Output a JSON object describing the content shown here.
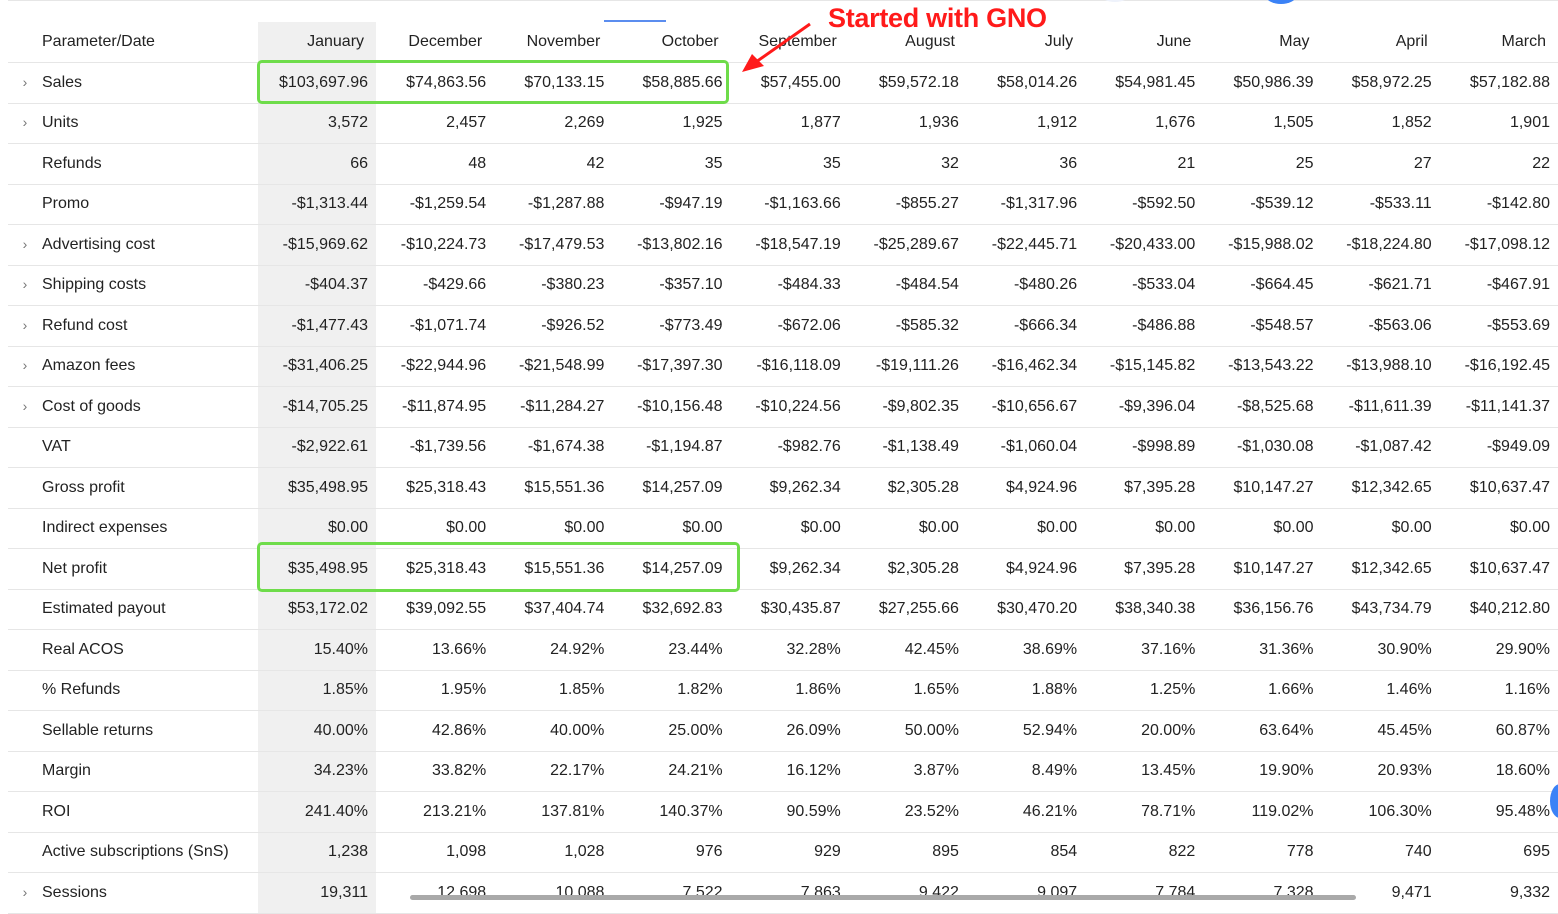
{
  "table": {
    "header_label": "Parameter/Date",
    "months": [
      "January",
      "December",
      "November",
      "October",
      "September",
      "August",
      "July",
      "June",
      "May",
      "April",
      "March"
    ],
    "rows": [
      {
        "label": "Sales",
        "expandable": true,
        "values": [
          "$103,697.96",
          "$74,863.56",
          "$70,133.15",
          "$58,885.66",
          "$57,455.00",
          "$59,572.18",
          "$58,014.26",
          "$54,981.45",
          "$50,986.39",
          "$58,972.25",
          "$57,182.88"
        ]
      },
      {
        "label": "Units",
        "expandable": true,
        "values": [
          "3,572",
          "2,457",
          "2,269",
          "1,925",
          "1,877",
          "1,936",
          "1,912",
          "1,676",
          "1,505",
          "1,852",
          "1,901"
        ]
      },
      {
        "label": "Refunds",
        "expandable": false,
        "values": [
          "66",
          "48",
          "42",
          "35",
          "35",
          "32",
          "36",
          "21",
          "25",
          "27",
          "22"
        ]
      },
      {
        "label": "Promo",
        "expandable": false,
        "values": [
          "-$1,313.44",
          "-$1,259.54",
          "-$1,287.88",
          "-$947.19",
          "-$1,163.66",
          "-$855.27",
          "-$1,317.96",
          "-$592.50",
          "-$539.12",
          "-$533.11",
          "-$142.80"
        ]
      },
      {
        "label": "Advertising cost",
        "expandable": true,
        "values": [
          "-$15,969.62",
          "-$10,224.73",
          "-$17,479.53",
          "-$13,802.16",
          "-$18,547.19",
          "-$25,289.67",
          "-$22,445.71",
          "-$20,433.00",
          "-$15,988.02",
          "-$18,224.80",
          "-$17,098.12"
        ]
      },
      {
        "label": "Shipping costs",
        "expandable": true,
        "values": [
          "-$404.37",
          "-$429.66",
          "-$380.23",
          "-$357.10",
          "-$484.33",
          "-$484.54",
          "-$480.26",
          "-$533.04",
          "-$664.45",
          "-$621.71",
          "-$467.91"
        ]
      },
      {
        "label": "Refund cost",
        "expandable": true,
        "values": [
          "-$1,477.43",
          "-$1,071.74",
          "-$926.52",
          "-$773.49",
          "-$672.06",
          "-$585.32",
          "-$666.34",
          "-$486.88",
          "-$548.57",
          "-$563.06",
          "-$553.69"
        ]
      },
      {
        "label": "Amazon fees",
        "expandable": true,
        "values": [
          "-$31,406.25",
          "-$22,944.96",
          "-$21,548.99",
          "-$17,397.30",
          "-$16,118.09",
          "-$19,111.26",
          "-$16,462.34",
          "-$15,145.82",
          "-$13,543.22",
          "-$13,988.10",
          "-$16,192.45"
        ]
      },
      {
        "label": "Cost of goods",
        "expandable": true,
        "values": [
          "-$14,705.25",
          "-$11,874.95",
          "-$11,284.27",
          "-$10,156.48",
          "-$10,224.56",
          "-$9,802.35",
          "-$10,656.67",
          "-$9,396.04",
          "-$8,525.68",
          "-$11,611.39",
          "-$11,141.37"
        ]
      },
      {
        "label": "VAT",
        "expandable": false,
        "values": [
          "-$2,922.61",
          "-$1,739.56",
          "-$1,674.38",
          "-$1,194.87",
          "-$982.76",
          "-$1,138.49",
          "-$1,060.04",
          "-$998.89",
          "-$1,030.08",
          "-$1,087.42",
          "-$949.09"
        ]
      },
      {
        "label": "Gross profit",
        "expandable": false,
        "values": [
          "$35,498.95",
          "$25,318.43",
          "$15,551.36",
          "$14,257.09",
          "$9,262.34",
          "$2,305.28",
          "$4,924.96",
          "$7,395.28",
          "$10,147.27",
          "$12,342.65",
          "$10,637.47"
        ]
      },
      {
        "label": "Indirect expenses",
        "expandable": false,
        "values": [
          "$0.00",
          "$0.00",
          "$0.00",
          "$0.00",
          "$0.00",
          "$0.00",
          "$0.00",
          "$0.00",
          "$0.00",
          "$0.00",
          "$0.00"
        ]
      },
      {
        "label": "Net profit",
        "expandable": false,
        "values": [
          "$35,498.95",
          "$25,318.43",
          "$15,551.36",
          "$14,257.09",
          "$9,262.34",
          "$2,305.28",
          "$4,924.96",
          "$7,395.28",
          "$10,147.27",
          "$12,342.65",
          "$10,637.47"
        ]
      },
      {
        "label": "Estimated payout",
        "expandable": false,
        "values": [
          "$53,172.02",
          "$39,092.55",
          "$37,404.74",
          "$32,692.83",
          "$30,435.87",
          "$27,255.66",
          "$30,470.20",
          "$38,340.38",
          "$36,156.76",
          "$43,734.79",
          "$40,212.80"
        ]
      },
      {
        "label": "Real ACOS",
        "expandable": false,
        "values": [
          "15.40%",
          "13.66%",
          "24.92%",
          "23.44%",
          "32.28%",
          "42.45%",
          "38.69%",
          "37.16%",
          "31.36%",
          "30.90%",
          "29.90%"
        ]
      },
      {
        "label": "% Refunds",
        "expandable": false,
        "values": [
          "1.85%",
          "1.95%",
          "1.85%",
          "1.82%",
          "1.86%",
          "1.65%",
          "1.88%",
          "1.25%",
          "1.66%",
          "1.46%",
          "1.16%"
        ]
      },
      {
        "label": "Sellable returns",
        "expandable": false,
        "values": [
          "40.00%",
          "42.86%",
          "40.00%",
          "25.00%",
          "26.09%",
          "50.00%",
          "52.94%",
          "20.00%",
          "63.64%",
          "45.45%",
          "60.87%"
        ]
      },
      {
        "label": "Margin",
        "expandable": false,
        "values": [
          "34.23%",
          "33.82%",
          "22.17%",
          "24.21%",
          "16.12%",
          "3.87%",
          "8.49%",
          "13.45%",
          "19.90%",
          "20.93%",
          "18.60%"
        ]
      },
      {
        "label": "ROI",
        "expandable": false,
        "values": [
          "241.40%",
          "213.21%",
          "137.81%",
          "140.37%",
          "90.59%",
          "23.52%",
          "46.21%",
          "78.71%",
          "119.02%",
          "106.30%",
          "95.48%"
        ]
      },
      {
        "label": "Active subscriptions (SnS)",
        "expandable": false,
        "values": [
          "1,238",
          "1,098",
          "1,028",
          "976",
          "929",
          "895",
          "854",
          "822",
          "778",
          "740",
          "695"
        ]
      },
      {
        "label": "Sessions",
        "expandable": true,
        "values": [
          "19,311",
          "12,698",
          "10,088",
          "7,522",
          "7,863",
          "9,422",
          "9,097",
          "7,784",
          "7,328",
          "9,471",
          "9,332"
        ]
      }
    ]
  },
  "annotation": {
    "text": "Started with GNO",
    "color": "#ff1a1a",
    "highlight_color": "#6edc4a"
  },
  "icons": {
    "expand": "chevron-right-icon"
  }
}
